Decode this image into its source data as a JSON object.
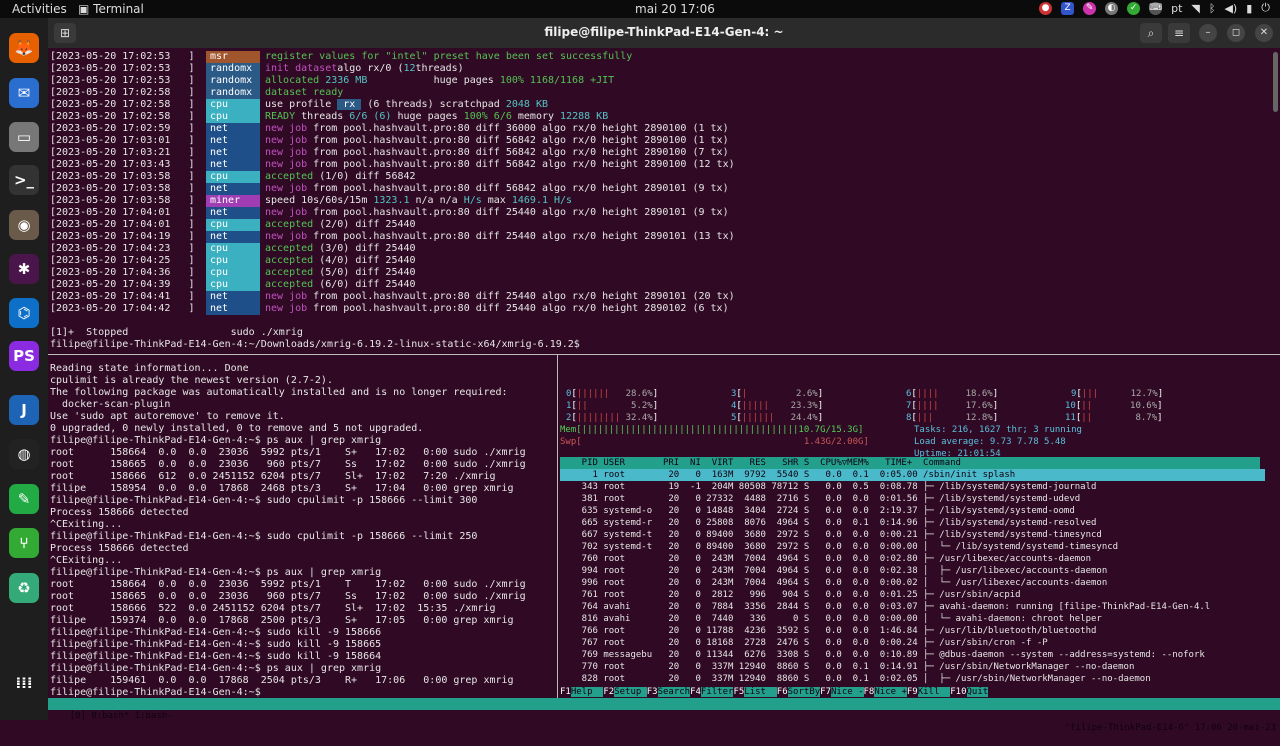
{
  "topbar": {
    "activities": "Activities",
    "app": "Terminal",
    "clock": "mai 20  17:06",
    "lang": "pt"
  },
  "dock": [
    {
      "name": "firefox-icon",
      "glyph": "🦊",
      "bg": "#e66000"
    },
    {
      "name": "thunderbird-icon",
      "glyph": "✉",
      "bg": "#2a6fd0"
    },
    {
      "name": "files-icon",
      "glyph": "▭",
      "bg": "#777"
    },
    {
      "name": "terminal-icon",
      "glyph": ">_",
      "bg": "#333"
    },
    {
      "name": "gimp-icon",
      "glyph": "◉",
      "bg": "#6a5a4a"
    },
    {
      "name": "slack-icon",
      "glyph": "✱",
      "bg": "#4a154b"
    },
    {
      "name": "vscode-icon",
      "glyph": "⌬",
      "bg": "#0e6fc8"
    },
    {
      "name": "phpstorm-icon",
      "glyph": "PS",
      "bg": "#8a2be2"
    },
    {
      "name": "joplin-icon",
      "glyph": "J",
      "bg": "#1d64b6"
    },
    {
      "name": "obs-icon",
      "glyph": "◍",
      "bg": "#222"
    },
    {
      "name": "editor-icon",
      "glyph": "✎",
      "bg": "#2a4"
    },
    {
      "name": "git-icon",
      "glyph": "⑂",
      "bg": "#3a3"
    },
    {
      "name": "trash-icon",
      "glyph": "♻",
      "bg": "#3a7"
    },
    {
      "name": "apps-grid-icon",
      "glyph": "⁞⁞⁞",
      "bg": "#1e1e1e"
    }
  ],
  "window": {
    "title": "filipe@filipe-ThinkPad-E14-Gen-4: ~"
  },
  "log": [
    {
      "ts": "[2023-05-20 17:02:53   ]",
      "tag": "msr",
      "cls": "msr",
      "parts": [
        [
          "c-g",
          "register values for \"intel\" preset have been set successfully"
        ]
      ]
    },
    {
      "ts": "[2023-05-20 17:02:53   ]",
      "tag": "randomx",
      "cls": "randomx",
      "parts": [
        [
          "c-m",
          "init dataset"
        ],
        [
          "",
          "algo rx/0 ("
        ],
        [
          "c-c",
          "12"
        ],
        [
          "",
          "threads)"
        ]
      ]
    },
    {
      "ts": "[2023-05-20 17:02:53   ]",
      "tag": "randomx",
      "cls": "randomx",
      "parts": [
        [
          "c-g",
          "allocated"
        ],
        [
          "c-c",
          " 2336 MB"
        ],
        [
          "",
          "           huge pages "
        ],
        [
          "c-g",
          "100% 1168/1168 +JIT"
        ]
      ]
    },
    {
      "ts": "[2023-05-20 17:02:58   ]",
      "tag": "randomx",
      "cls": "randomx",
      "parts": [
        [
          "c-g",
          "dataset ready"
        ]
      ]
    },
    {
      "ts": "[2023-05-20 17:02:58   ]",
      "tag": "cpu",
      "cls": "cpu",
      "parts": [
        [
          "",
          "use profile "
        ],
        [
          "c-w",
          " rx "
        ],
        [
          "",
          " (6 threads) scratchpad "
        ],
        [
          "c-c",
          "2048 KB"
        ]
      ]
    },
    {
      "ts": "[2023-05-20 17:02:58   ]",
      "tag": "cpu",
      "cls": "cpu",
      "parts": [
        [
          "c-g",
          "READY"
        ],
        [
          "",
          " threads "
        ],
        [
          "c-c",
          "6/6 (6)"
        ],
        [
          "",
          " huge pages "
        ],
        [
          "c-g",
          "100% 6/6"
        ],
        [
          "",
          " memory "
        ],
        [
          "c-c",
          "12288 KB"
        ]
      ]
    },
    {
      "ts": "[2023-05-20 17:02:59   ]",
      "tag": "net",
      "cls": "net",
      "parts": [
        [
          "c-m",
          "new job"
        ],
        [
          "",
          " from pool.hashvault.pro:80 diff 36000 algo rx/0 height 2890100 (1 tx)"
        ]
      ]
    },
    {
      "ts": "[2023-05-20 17:03:01   ]",
      "tag": "net",
      "cls": "net",
      "parts": [
        [
          "c-m",
          "new job"
        ],
        [
          "",
          " from pool.hashvault.pro:80 diff 56842 algo rx/0 height 2890100 (1 tx)"
        ]
      ]
    },
    {
      "ts": "[2023-05-20 17:03:21   ]",
      "tag": "net",
      "cls": "net",
      "parts": [
        [
          "c-m",
          "new job"
        ],
        [
          "",
          " from pool.hashvault.pro:80 diff 56842 algo rx/0 height 2890100 (7 tx)"
        ]
      ]
    },
    {
      "ts": "[2023-05-20 17:03:43   ]",
      "tag": "net",
      "cls": "net",
      "parts": [
        [
          "c-m",
          "new job"
        ],
        [
          "",
          " from pool.hashvault.pro:80 diff 56842 algo rx/0 height 2890100 (12 tx)"
        ]
      ]
    },
    {
      "ts": "[2023-05-20 17:03:58   ]",
      "tag": "cpu",
      "cls": "cpu",
      "parts": [
        [
          "c-g",
          "accepted"
        ],
        [
          "",
          " (1/0) diff 56842"
        ]
      ]
    },
    {
      "ts": "[2023-05-20 17:03:58   ]",
      "tag": "net",
      "cls": "net",
      "parts": [
        [
          "c-m",
          "new job"
        ],
        [
          "",
          " from pool.hashvault.pro:80 diff 56842 algo rx/0 height 2890101 (9 tx)"
        ]
      ]
    },
    {
      "ts": "[2023-05-20 17:03:58   ]",
      "tag": "miner",
      "cls": "miner",
      "parts": [
        [
          "",
          "speed 10s/60s/15m "
        ],
        [
          "c-c",
          "1323.1"
        ],
        [
          "",
          " n/a n/a "
        ],
        [
          "c-c",
          "H/s"
        ],
        [
          "",
          " max "
        ],
        [
          "c-c",
          "1469.1 H/s"
        ]
      ]
    },
    {
      "ts": "[2023-05-20 17:04:01   ]",
      "tag": "net",
      "cls": "net",
      "parts": [
        [
          "c-m",
          "new job"
        ],
        [
          "",
          " from pool.hashvault.pro:80 diff 25440 algo rx/0 height 2890101 (9 tx)"
        ]
      ]
    },
    {
      "ts": "[2023-05-20 17:04:01   ]",
      "tag": "cpu",
      "cls": "cpu",
      "parts": [
        [
          "c-g",
          "accepted"
        ],
        [
          "",
          " (2/0) diff 25440"
        ]
      ]
    },
    {
      "ts": "[2023-05-20 17:04:19   ]",
      "tag": "net",
      "cls": "net",
      "parts": [
        [
          "c-m",
          "new job"
        ],
        [
          "",
          " from pool.hashvault.pro:80 diff 25440 algo rx/0 height 2890101 (13 tx)"
        ]
      ]
    },
    {
      "ts": "[2023-05-20 17:04:23   ]",
      "tag": "cpu",
      "cls": "cpu",
      "parts": [
        [
          "c-g",
          "accepted"
        ],
        [
          "",
          " (3/0) diff 25440"
        ]
      ]
    },
    {
      "ts": "[2023-05-20 17:04:25   ]",
      "tag": "cpu",
      "cls": "cpu",
      "parts": [
        [
          "c-g",
          "accepted"
        ],
        [
          "",
          " (4/0) diff 25440"
        ]
      ]
    },
    {
      "ts": "[2023-05-20 17:04:36   ]",
      "tag": "cpu",
      "cls": "cpu",
      "parts": [
        [
          "c-g",
          "accepted"
        ],
        [
          "",
          " (5/0) diff 25440"
        ]
      ]
    },
    {
      "ts": "[2023-05-20 17:04:39   ]",
      "tag": "cpu",
      "cls": "cpu",
      "parts": [
        [
          "c-g",
          "accepted"
        ],
        [
          "",
          " (6/0) diff 25440"
        ]
      ]
    },
    {
      "ts": "[2023-05-20 17:04:41   ]",
      "tag": "net",
      "cls": "net",
      "parts": [
        [
          "c-m",
          "new job"
        ],
        [
          "",
          " from pool.hashvault.pro:80 diff 25440 algo rx/0 height 2890101 (20 tx)"
        ]
      ]
    },
    {
      "ts": "[2023-05-20 17:04:42   ]",
      "tag": "net",
      "cls": "net",
      "parts": [
        [
          "c-m",
          "new job"
        ],
        [
          "",
          " from pool.hashvault.pro:80 diff 25440 algo rx/0 height 2890102 (6 tx)"
        ]
      ]
    }
  ],
  "stopped": "[1]+  Stopped                 sudo ./xmrig",
  "prompt1": "filipe@filipe-ThinkPad-E14-Gen-4:~/Downloads/xmrig-6.19.2-linux-static-x64/xmrig-6.19.2$",
  "bash": [
    "Reading state information... Done",
    "cpulimit is already the newest version (2.7-2).",
    "The following package was automatically installed and is no longer required:",
    "  docker-scan-plugin",
    "Use 'sudo apt autoremove' to remove it.",
    "0 upgraded, 0 newly installed, 0 to remove and 5 not upgraded.",
    "filipe@filipe-ThinkPad-E14-Gen-4:~$ ps aux | grep xmrig",
    "root      158664  0.0  0.0  23036  5992 pts/1    S+   17:02   0:00 sudo ./xmrig",
    "root      158665  0.0  0.0  23036   960 pts/7    Ss   17:02   0:00 sudo ./xmrig",
    "root      158666  612  0.0 2451152 6204 pts/7    Sl+  17:02   7:20 ./xmrig",
    "filipe    158954  0.0  0.0  17868  2468 pts/3    S+   17:04   0:00 grep xmrig",
    "filipe@filipe-ThinkPad-E14-Gen-4:~$ sudo cpulimit -p 158666 --limit 300",
    "Process 158666 detected",
    "^CExiting...",
    "filipe@filipe-ThinkPad-E14-Gen-4:~$ sudo cpulimit -p 158666 --limit 250",
    "Process 158666 detected",
    "^CExiting...",
    "filipe@filipe-ThinkPad-E14-Gen-4:~$ ps aux | grep xmrig",
    "root      158664  0.0  0.0  23036  5992 pts/1    T    17:02   0:00 sudo ./xmrig",
    "root      158665  0.0  0.0  23036   960 pts/7    Ss   17:02   0:00 sudo ./xmrig",
    "root      158666  522  0.0 2451152 6204 pts/7    Sl+  17:02  15:35 ./xmrig",
    "filipe    159374  0.0  0.0  17868  2500 pts/3    S+   17:05   0:00 grep xmrig",
    "filipe@filipe-ThinkPad-E14-Gen-4:~$ sudo kill -9 158666",
    "filipe@filipe-ThinkPad-E14-Gen-4:~$ sudo kill -9 158665",
    "filipe@filipe-ThinkPad-E14-Gen-4:~$ sudo kill -9 158664",
    "filipe@filipe-ThinkPad-E14-Gen-4:~$ ps aux | grep xmrig",
    "filipe    159461  0.0  0.0  17868  2504 pts/3    R+   17:06   0:00 grep xmrig",
    "filipe@filipe-ThinkPad-E14-Gen-4:~$ "
  ],
  "htop": {
    "cpus": [
      {
        "id": "0",
        "bar": "||||||",
        "pct": "28.6%"
      },
      {
        "id": "1",
        "bar": "||",
        "pct": "5.2%"
      },
      {
        "id": "2",
        "bar": "||||||||",
        "pct": "32.4%"
      },
      {
        "id": "3",
        "bar": "|",
        "pct": "2.6%"
      },
      {
        "id": "4",
        "bar": "|||||",
        "pct": "23.3%"
      },
      {
        "id": "5",
        "bar": "||||||",
        "pct": "24.4%"
      },
      {
        "id": "6",
        "bar": "||||",
        "pct": "18.6%"
      },
      {
        "id": "7",
        "bar": "||||",
        "pct": "17.6%"
      },
      {
        "id": "8",
        "bar": "|||",
        "pct": "12.8%"
      },
      {
        "id": "9",
        "bar": "|||",
        "pct": "12.7%"
      },
      {
        "id": "10",
        "bar": "||",
        "pct": "10.6%"
      },
      {
        "id": "11",
        "bar": "||",
        "pct": "8.7%"
      }
    ],
    "mem": "Mem[||||||||||||||||||||||||||||||||||||||||10.7G/15.3G]",
    "swp": "Swp[                                         1.43G/2.00G]",
    "tasks": "Tasks: 216, 1627 thr; 3 running",
    "load": "Load average: 9.73 7.78 5.48",
    "uptime": "Uptime: 21:01:54",
    "header": "    PID USER       PRI  NI  VIRT   RES   SHR S  CPU%▽MEM%   TIME+  Command",
    "rows": [
      "      1 root        20   0  163M  9792  5540 S   0.0  0.1  0:05.00 /sbin/init splash",
      "    343 root        19  -1  204M 80508 78712 S   0.0  0.5  0:08.78 ├─ /lib/systemd/systemd-journald",
      "    381 root        20   0 27332  4488  2716 S   0.0  0.0  0:01.56 ├─ /lib/systemd/systemd-udevd",
      "    635 systemd-o   20   0 14848  3404  2724 S   0.0  0.0  2:19.37 ├─ /lib/systemd/systemd-oomd",
      "    665 systemd-r   20   0 25808  8076  4964 S   0.0  0.1  0:14.96 ├─ /lib/systemd/systemd-resolved",
      "    667 systemd-t   20   0 89400  3680  2972 S   0.0  0.0  0:00.21 ├─ /lib/systemd/systemd-timesyncd",
      "    702 systemd-t   20   0 89400  3680  2972 S   0.0  0.0  0:00.00 │  └─ /lib/systemd/systemd-timesyncd",
      "    760 root        20   0  243M  7004  4964 S   0.0  0.0  0:02.80 ├─ /usr/libexec/accounts-daemon",
      "    994 root        20   0  243M  7004  4964 S   0.0  0.0  0:02.38 │  ├─ /usr/libexec/accounts-daemon",
      "    996 root        20   0  243M  7004  4964 S   0.0  0.0  0:00.02 │  └─ /usr/libexec/accounts-daemon",
      "    761 root        20   0  2812   996   904 S   0.0  0.0  0:01.25 ├─ /usr/sbin/acpid",
      "    764 avahi       20   0  7884  3356  2844 S   0.0  0.0  0:03.07 ├─ avahi-daemon: running [filipe-ThinkPad-E14-Gen-4.l",
      "    816 avahi       20   0  7440   336     0 S   0.0  0.0  0:00.00 │  └─ avahi-daemon: chroot helper",
      "    766 root        20   0 11788  4236  3592 S   0.0  0.0  1:46.84 ├─ /usr/lib/bluetooth/bluetoothd",
      "    767 root        20   0 18168  2728  2476 S   0.0  0.0  0:00.24 ├─ /usr/sbin/cron -f -P",
      "    769 messagebu   20   0 11344  6276  3308 S   0.0  0.0  0:10.89 ├─ @dbus-daemon --system --address=systemd: --nofork",
      "    770 root        20   0  337M 12940  8860 S   0.0  0.1  0:14.91 ├─ /usr/sbin/NetworkManager --no-daemon",
      "    828 root        20   0  337M 12940  8860 S   0.0  0.1  0:02.05 │  ├─ /usr/sbin/NetworkManager --no-daemon"
    ],
    "fkeys": [
      [
        "F1",
        "Help  "
      ],
      [
        "F2",
        "Setup "
      ],
      [
        "F3",
        "Search"
      ],
      [
        "F4",
        "Filter"
      ],
      [
        "F5",
        "List  "
      ],
      [
        "F6",
        "SortBy"
      ],
      [
        "F7",
        "Nice -"
      ],
      [
        "F8",
        "Nice +"
      ],
      [
        "F9",
        "Kill  "
      ],
      [
        "F10",
        "Quit"
      ]
    ]
  },
  "tmux": {
    "left": "[0] 0:bash* 1:bash-",
    "right": "\"filipe-ThinkPad-E14-G\" 17:06 20-mai-23"
  }
}
